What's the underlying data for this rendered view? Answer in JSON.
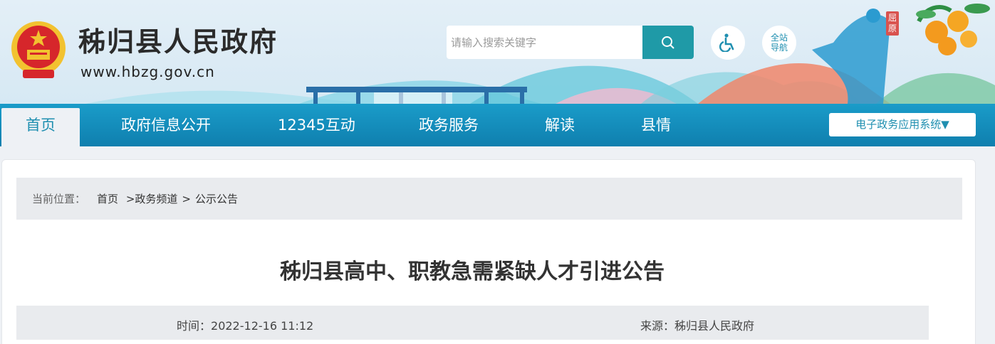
{
  "header": {
    "site_name": "秭归县人民政府",
    "site_url": "www.hbzg.gov.cn",
    "search": {
      "placeholder": "请输入搜索关键字",
      "icon": "search-icon"
    },
    "accessibility_icon": "wheelchair-icon",
    "site_nav": {
      "line1": "全站",
      "line2": "导航"
    },
    "stamp_text": "屈原"
  },
  "nav": {
    "items": [
      "首页",
      "政府信息公开",
      "12345互动",
      "政务服务",
      "解读",
      "县情"
    ],
    "active_index": 0,
    "system_button": "电子政务应用系统▼"
  },
  "breadcrumb": {
    "label": "当前位置：",
    "items": [
      "首页",
      ">政务频道",
      ">",
      "公示公告"
    ]
  },
  "article": {
    "title": "秭归县高中、职教急需紧缺人才引进公告",
    "time_label": "时间：",
    "time_value": "2022-12-16 11:12",
    "source_label": "来源：",
    "source_value": "秭归县人民政府"
  },
  "colors": {
    "nav_blue": "#1a9cc9",
    "accent_teal": "#1f9aa7",
    "emblem_red": "#d6262b",
    "emblem_gold": "#f2c230"
  }
}
